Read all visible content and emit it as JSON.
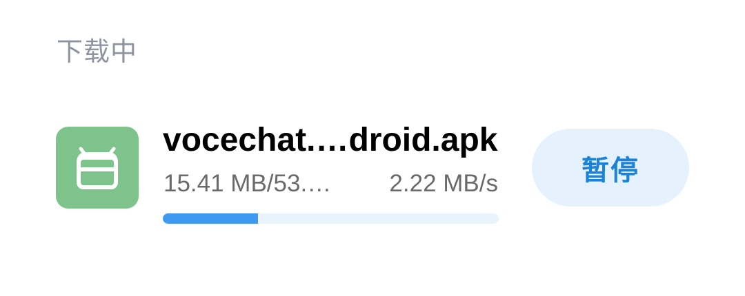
{
  "section": {
    "title": "下载中"
  },
  "download": {
    "app_icon": "android-icon",
    "file_name": "vocechat.…droid.apk",
    "progress_text": "15.41 MB/53.…",
    "speed_text": "2.22 MB/s",
    "progress_fraction": 0.2838,
    "pause_label": "暂停"
  },
  "colors": {
    "icon_bg": "#7ec38c",
    "accent": "#1a82d9",
    "progress_fill": "#3d9af0",
    "progress_track": "#e9f3fc",
    "button_bg": "#e5f1fc"
  }
}
